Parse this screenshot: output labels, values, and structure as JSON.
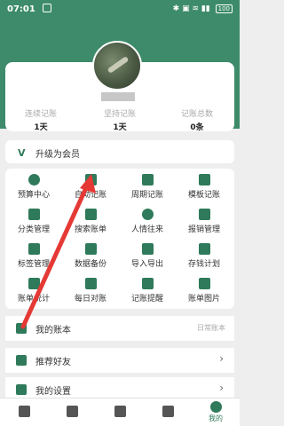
{
  "status_bar": {
    "time": "07:01",
    "right_icons": "✱ ▣ ≋ ▮▮",
    "battery": "100"
  },
  "profile": {
    "stats": [
      {
        "label": "连续记账",
        "value": "1天"
      },
      {
        "label": "坚持记账",
        "value": "1天"
      },
      {
        "label": "记账总数",
        "value": "0条"
      }
    ]
  },
  "vip": {
    "icon": "vip-icon",
    "label": "升级为会员"
  },
  "features": [
    {
      "label": "预算中心",
      "icon": "budget-icon"
    },
    {
      "label": "自动记账",
      "icon": "auto-record-icon"
    },
    {
      "label": "周期记账",
      "icon": "periodic-icon"
    },
    {
      "label": "模板记账",
      "icon": "template-icon"
    },
    {
      "label": "分类管理",
      "icon": "category-icon"
    },
    {
      "label": "搜索账单",
      "icon": "search-bill-icon"
    },
    {
      "label": "人情往来",
      "icon": "relation-icon"
    },
    {
      "label": "报销管理",
      "icon": "reimburse-icon"
    },
    {
      "label": "标签管理",
      "icon": "tag-icon"
    },
    {
      "label": "数据备份",
      "icon": "backup-icon"
    },
    {
      "label": "导入导出",
      "icon": "import-export-icon"
    },
    {
      "label": "存钱计划",
      "icon": "saving-plan-icon"
    },
    {
      "label": "账单统计",
      "icon": "statistics-icon"
    },
    {
      "label": "每日对账",
      "icon": "daily-check-icon"
    },
    {
      "label": "记账提醒",
      "icon": "reminder-icon"
    },
    {
      "label": "账单图片",
      "icon": "bill-image-icon"
    }
  ],
  "menu": [
    {
      "label": "我的账本",
      "right": "日常账本"
    },
    {
      "label": "推荐好友",
      "right": "›"
    },
    {
      "label": "我的设置",
      "right": "›"
    }
  ],
  "tabs": [
    {
      "label": "",
      "icon": "home-icon"
    },
    {
      "label": "",
      "icon": "calendar-icon"
    },
    {
      "label": "",
      "icon": "chart-icon"
    },
    {
      "label": "",
      "icon": "wallet-icon"
    },
    {
      "label": "我的",
      "icon": "profile-icon"
    }
  ],
  "colors": {
    "accent": "#3d8b6a",
    "annotation_arrow": "#e53935"
  }
}
